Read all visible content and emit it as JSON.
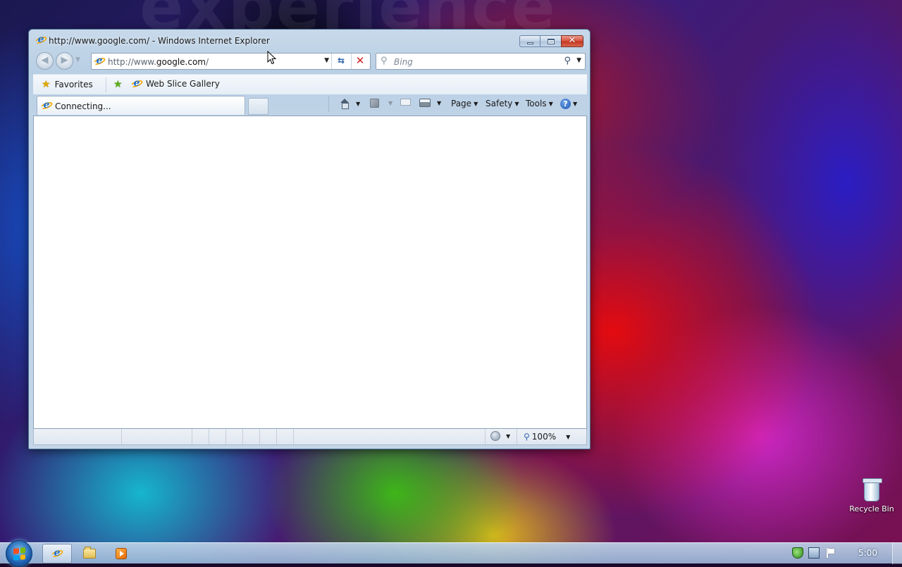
{
  "desktop": {
    "wallpaper_text": "experience",
    "icons": [
      {
        "label": "Recycle Bin",
        "icon": "recycle-bin-icon"
      }
    ]
  },
  "window": {
    "title": "http://www.google.com/ - Windows Internet Explorer",
    "address": {
      "prefix": "http://www.",
      "host": "google.com",
      "suffix": "/"
    },
    "search": {
      "placeholder": "Bing"
    },
    "favorites_bar": {
      "favorites_label": "Favorites",
      "web_slice_label": "Web Slice Gallery"
    },
    "tab": {
      "label": "Connecting..."
    },
    "command_bar": {
      "page_label": "Page",
      "safety_label": "Safety",
      "tools_label": "Tools"
    },
    "status_bar": {
      "zoom": "100%"
    }
  },
  "taskbar": {
    "clock": "5:00",
    "pinned": [
      "internet-explorer",
      "windows-explorer",
      "windows-media-player"
    ],
    "tray": [
      "action-center-icon",
      "network-icon",
      "flag-icon"
    ]
  }
}
